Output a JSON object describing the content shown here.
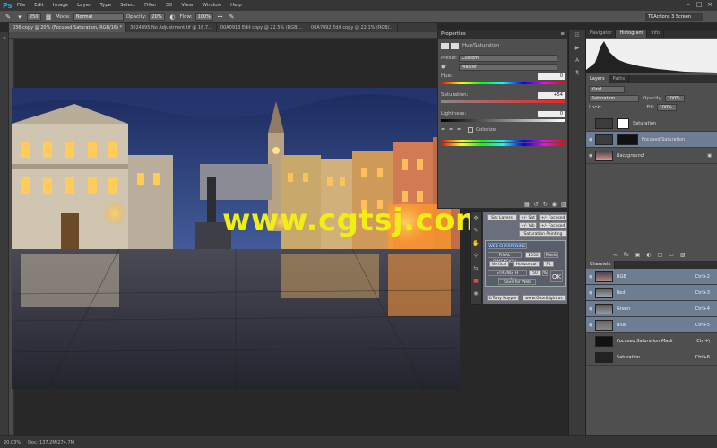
{
  "app": {
    "logo": "Ps"
  },
  "menu": [
    "File",
    "Edit",
    "Image",
    "Layer",
    "Type",
    "Select",
    "Filter",
    "3D",
    "View",
    "Window",
    "Help"
  ],
  "options_bar": {
    "brush_size": "250",
    "mode_label": "Mode:",
    "mode_value": "Normal",
    "opacity_label": "Opacity:",
    "opacity_value": "20%",
    "flow_label": "Flow:",
    "flow_value": "100%",
    "workspace": "TKActions 3 Screen"
  },
  "doc_tabs": [
    "036 copy @ 20% (Focused Saturation, RGB/16) *",
    "3024895 No Adjustment.tif @ 16.7...",
    "00A0913 Edit copy @ 22.5% (RGB/...",
    "00A7092 Edit copy @ 22.1% (RGB/..."
  ],
  "properties": {
    "tab": "Properties",
    "title": "Hue/Saturation",
    "preset_label": "Preset:",
    "preset_value": "Custom",
    "channel_value": "Master",
    "hue_label": "Hue:",
    "hue_value": "0",
    "saturation_label": "Saturation:",
    "saturation_value": "+54",
    "lightness_label": "Lightness:",
    "lightness_value": "0",
    "colorize_label": "Colorize"
  },
  "navigator": {
    "tabs": [
      "Navigator",
      "Histogram",
      "Info"
    ]
  },
  "layers": {
    "tabs": [
      "Layers",
      "Paths"
    ],
    "kind": "Kind",
    "blend": "Saturation",
    "opacity_label": "Opacity:",
    "opacity_value": "100%",
    "lock_label": "Lock:",
    "fill_label": "Fill:",
    "fill_value": "100%",
    "items": [
      {
        "name": "Saturation"
      },
      {
        "name": "Focused Saturation"
      },
      {
        "name": "Background"
      }
    ]
  },
  "channels": {
    "tab": "Channels",
    "items": [
      {
        "name": "RGB",
        "shortcut": "Ctrl+2"
      },
      {
        "name": "Red",
        "shortcut": "Ctrl+3"
      },
      {
        "name": "Green",
        "shortcut": "Ctrl+4"
      },
      {
        "name": "Blue",
        "shortcut": "Ctrl+5"
      },
      {
        "name": "Focused Saturation Mask",
        "shortcut": "Ctrl+\\"
      },
      {
        "name": "Saturation",
        "shortcut": "Ctrl+6"
      }
    ]
  },
  "script_panel": {
    "sat_layers": "Sat Layers",
    "sat_plus": "+/- Sat",
    "focused_sat": "+/- Focused Sat",
    "vib_plus": "+/- Vib",
    "focused_vib": "+/- Focused Vib",
    "sat_painting": "Saturation Painting",
    "web_sharpening": "WEB SHARPENING",
    "final_dimension": "FINAL DIMENSION",
    "dimension_value": "1050",
    "pixels": "Pixels",
    "vertical": "Vertical",
    "horizontal": "Horizontal",
    "fit": "Fit",
    "strength": "STRENGTH (opacity)",
    "strength_value": "50",
    "pct": "%",
    "ok": "OK",
    "save_web": "Save for Web",
    "credit": "©Tony Kuyper",
    "site": "www.GoodLight.us"
  },
  "status": {
    "zoom": "20.03%",
    "doc": "Doc: 137.2M/274.7M"
  },
  "watermark": "www.cgtsj.com"
}
